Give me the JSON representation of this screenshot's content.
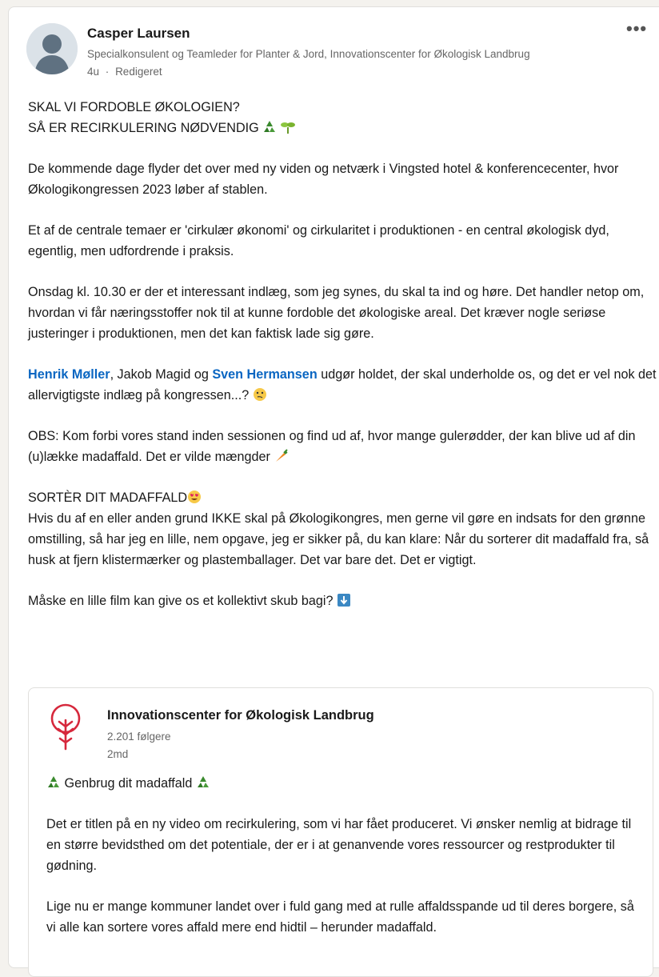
{
  "author": {
    "name": "Casper Laursen",
    "headline": "Specialkonsulent og Teamleder for Planter & Jord, Innovationscenter for Økologisk Landbrug",
    "time": "4u",
    "separator": "·",
    "edited": "Redigeret",
    "more_label": "•••"
  },
  "post": {
    "title1": "SKAL VI FORDOBLE ØKOLOGIEN?",
    "title2": "SÅ ER RECIRKULERING NØDVENDIG",
    "p1": "De kommende dage flyder det over med ny viden og netværk i Vingsted hotel & konferencecenter, hvor Økologikongressen 2023 løber af stablen.",
    "p2": "Et af de centrale temaer er 'cirkulær økonomi' og cirkularitet i produktionen - en central økologisk dyd, egentlig, men udfordrende i praksis.",
    "p3": "Onsdag kl. 10.30 er der et interessant indlæg, som jeg synes, du skal ta ind og høre. Det handler netop om, hvordan vi får næringsstoffer nok til at kunne fordoble det økologiske areal. Det kræver nogle seriøse justeringer i produktionen, men det kan faktisk lade sig gøre.",
    "mention1": "Henrik Møller",
    "p4_mid": ", Jakob Magid og ",
    "mention2": "Sven Hermansen",
    "p4_end": " udgør holdet, der skal underholde os, og det er vel nok det allervigtigste indlæg på kongressen...?",
    "p5": "OBS: Kom forbi vores stand inden sessionen og find ud af, hvor mange gulerødder, der kan blive ud af din (u)lække madaffald. Det er vilde mængder",
    "sort_title": "SORTÈR DIT MADAFFALD",
    "p6": "Hvis du af en eller anden grund IKKE skal på Økologikongres, men gerne vil gøre en indsats for den grønne omstilling, så har jeg en lille, nem opgave, jeg er sikker på, du kan klare: Når du sorterer dit madaffald fra, så husk at fjern klistermærker og plastemballager. Det var bare det. Det er vigtigt.",
    "p7": "Måske en lille film kan give os et kollektivt skub bagi?"
  },
  "shared": {
    "org_name": "Innovationscenter for Økologisk Landbrug",
    "followers": "2.201 følgere",
    "time": "2md",
    "title": "Genbrug dit madaffald",
    "p1": "Det er titlen på en ny video om recirkulering, som vi har fået produceret. Vi ønsker nemlig at bidrage til en større bevidsthed om det potentiale, der er i at genanvende vores ressourcer og restprodukter til gødning.",
    "p2": "Lige nu er mange kommuner landet over i fuld gang med at rulle affaldsspande ud til deres borgere, så vi alle kan sortere vores affald mere end hidtil – herunder madaffald."
  },
  "colors": {
    "link": "#0a66c2",
    "logo_red": "#d6283c"
  }
}
